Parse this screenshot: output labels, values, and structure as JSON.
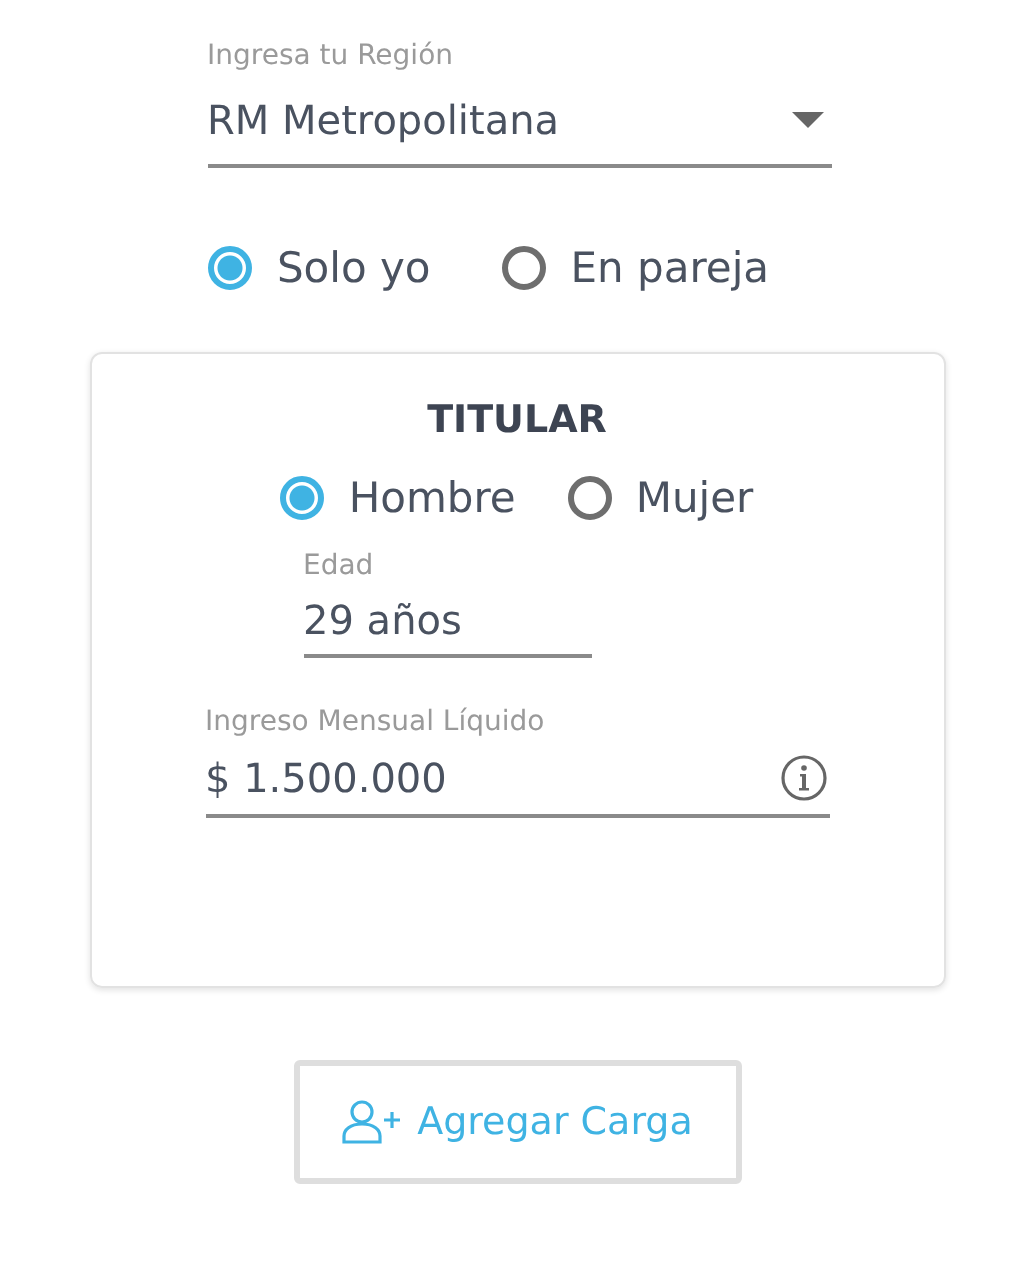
{
  "region_field": {
    "label": "Ingresa tu Región",
    "value": "RM Metropolitana"
  },
  "coverage_options": [
    {
      "label": "Solo yo",
      "selected": true
    },
    {
      "label": "En pareja",
      "selected": false
    }
  ],
  "titular_card": {
    "title": "TITULAR",
    "gender_options": [
      {
        "label": "Hombre",
        "selected": true
      },
      {
        "label": "Mujer",
        "selected": false
      }
    ],
    "age_field": {
      "label": "Edad",
      "value": "29 años"
    },
    "income_field": {
      "label": "Ingreso Mensual Líquido",
      "value": "$ 1.500.000"
    }
  },
  "add_button": {
    "label": "Agregar Carga"
  }
}
